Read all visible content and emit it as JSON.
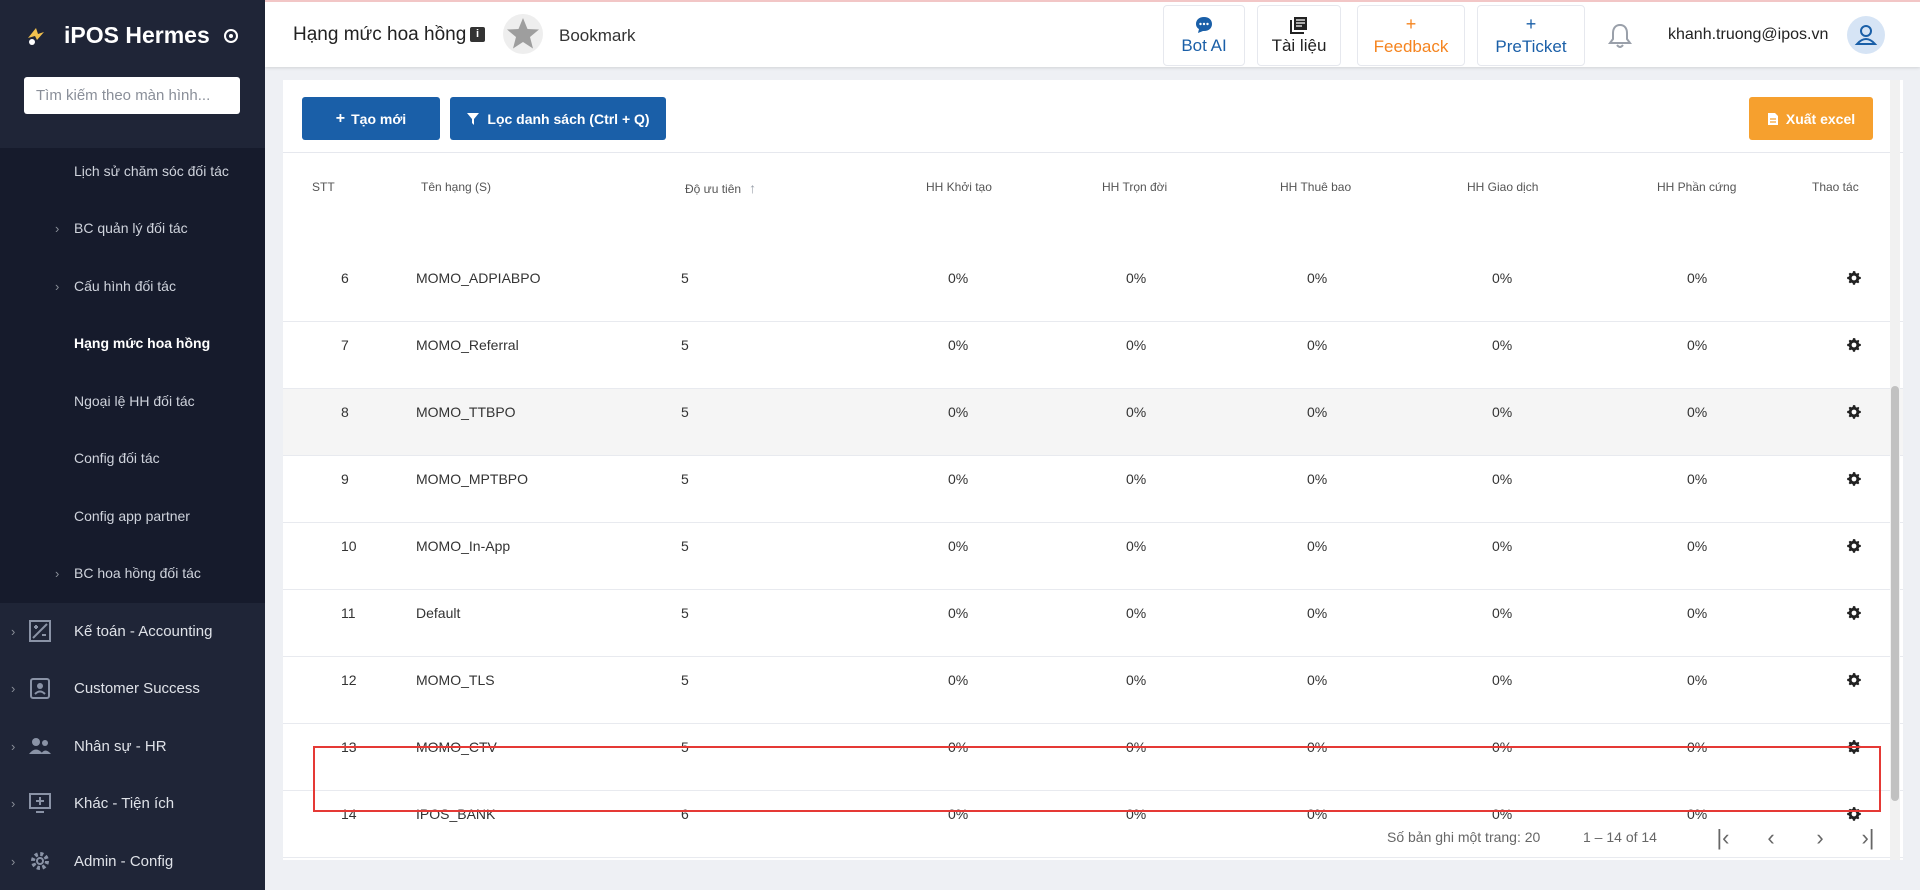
{
  "sidebar": {
    "app_name": "iPOS Hermes",
    "search_placeholder": "Tìm kiếm theo màn hình...",
    "sub_items": [
      {
        "label": "Lịch sử chăm sóc đối tác"
      },
      {
        "label": "BC quản lý đối tác"
      },
      {
        "label": "Cấu hình đối tác"
      },
      {
        "label": "Hạng mức hoa hồng"
      },
      {
        "label": "Ngoại lệ HH đối tác"
      },
      {
        "label": "Config đối tác"
      },
      {
        "label": "Config app partner"
      },
      {
        "label": "BC hoa hồng đối tác"
      }
    ],
    "main_items": [
      {
        "label": "Kế toán - Accounting",
        "icon": "accounting-icon"
      },
      {
        "label": "Customer Success",
        "icon": "customer-success-icon"
      },
      {
        "label": "Nhân sự - HR",
        "icon": "people-icon"
      },
      {
        "label": "Khác - Tiện ích",
        "icon": "monitor-plus-icon"
      },
      {
        "label": "Admin - Config",
        "icon": "gear-icon"
      }
    ]
  },
  "header": {
    "title": "Hạng mức hoa hồng",
    "info_badge": "i",
    "bookmark_label": "Bookmark",
    "buttons": {
      "bot_ai": "Bot AI",
      "tai_lieu": "Tài liệu",
      "feedback": "Feedback",
      "preticket": "PreTicket",
      "plus": "+"
    },
    "user_email": "khanh.truong@ipos.vn"
  },
  "toolbar": {
    "create_label": "Tạo mới",
    "filter_label": "Lọc danh sách (Ctrl + Q)",
    "export_label": "Xuất excel"
  },
  "table": {
    "headers": {
      "stt": "STT",
      "name": "Tên hạng (S)",
      "priority": "Độ ưu tiên",
      "init": "HH Khởi tạo",
      "lifetime": "HH Trọn đời",
      "subscription": "HH Thuê bao",
      "transaction": "HH Giao dịch",
      "hardware": "HH Phần cứng",
      "actions": "Thao tác"
    },
    "rows": [
      {
        "stt": "6",
        "name": "MOMO_ADPIABPO",
        "priority": "5",
        "init": "0%",
        "lifetime": "0%",
        "subscription": "0%",
        "transaction": "0%",
        "hardware": "0%"
      },
      {
        "stt": "7",
        "name": "MOMO_Referral",
        "priority": "5",
        "init": "0%",
        "lifetime": "0%",
        "subscription": "0%",
        "transaction": "0%",
        "hardware": "0%"
      },
      {
        "stt": "8",
        "name": "MOMO_TTBPO",
        "priority": "5",
        "init": "0%",
        "lifetime": "0%",
        "subscription": "0%",
        "transaction": "0%",
        "hardware": "0%"
      },
      {
        "stt": "9",
        "name": "MOMO_MPTBPO",
        "priority": "5",
        "init": "0%",
        "lifetime": "0%",
        "subscription": "0%",
        "transaction": "0%",
        "hardware": "0%"
      },
      {
        "stt": "10",
        "name": "MOMO_In-App",
        "priority": "5",
        "init": "0%",
        "lifetime": "0%",
        "subscription": "0%",
        "transaction": "0%",
        "hardware": "0%"
      },
      {
        "stt": "11",
        "name": "Default",
        "priority": "5",
        "init": "0%",
        "lifetime": "0%",
        "subscription": "0%",
        "transaction": "0%",
        "hardware": "0%"
      },
      {
        "stt": "12",
        "name": "MOMO_TLS",
        "priority": "5",
        "init": "0%",
        "lifetime": "0%",
        "subscription": "0%",
        "transaction": "0%",
        "hardware": "0%"
      },
      {
        "stt": "13",
        "name": "MOMO_CTV",
        "priority": "5",
        "init": "0%",
        "lifetime": "0%",
        "subscription": "0%",
        "transaction": "0%",
        "hardware": "0%"
      },
      {
        "stt": "14",
        "name": "IPOS_BANK",
        "priority": "6",
        "init": "0%",
        "lifetime": "0%",
        "subscription": "0%",
        "transaction": "0%",
        "hardware": "0%"
      }
    ]
  },
  "pagination": {
    "page_size_label": "Số bản ghi một trang: 20",
    "range_label": "1 – 14 of 14",
    "first": "|‹",
    "prev": "‹",
    "next": "›",
    "last": "›|"
  },
  "colors": {
    "sidebar_bg": "#1f2537",
    "primary_blue": "#1a5fa8",
    "export_orange": "#f6a02e",
    "feedback_orange": "#f5841f",
    "highlight_red": "#e53935"
  }
}
